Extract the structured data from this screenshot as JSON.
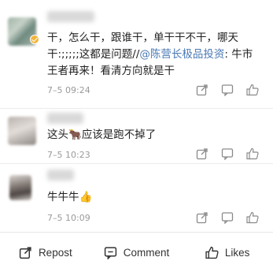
{
  "comments": [
    {
      "text_before": "干，怎么干，跟谁干，单干干不干，哪天干:;;;;;这都是问题//",
      "mention": "@陈营长极品投资",
      "text_after": ": 牛市王者再来！看清方向就是干",
      "time": "7–5 09:24"
    },
    {
      "text_before": "这头",
      "emoji": "🐂",
      "text_after": "应该是跑不掉了",
      "time": "7–5 10:23"
    },
    {
      "text_before": "牛牛牛",
      "emoji": "👍",
      "time": "7–5 10:09"
    }
  ],
  "action_icons": [
    "share-icon",
    "comment-icon",
    "like-icon"
  ],
  "bottom_bar": {
    "repost_label": "Repost",
    "comment_label": "Comment",
    "likes_label": "Likes"
  },
  "colors": {
    "link": "#4a78b5",
    "verified_badge": "#f2b53a",
    "time": "#9a9a9a"
  }
}
